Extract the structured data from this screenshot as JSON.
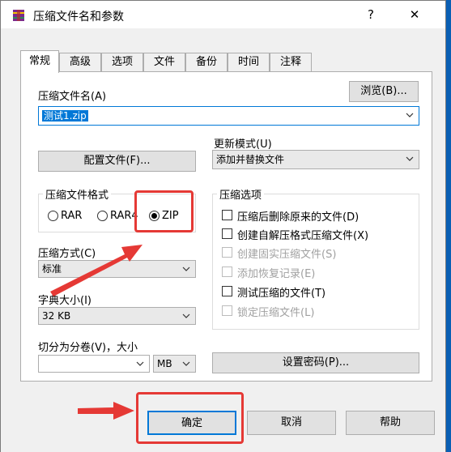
{
  "window": {
    "title": "压缩文件名和参数",
    "help_label": "?",
    "close_label": "✕"
  },
  "tabs": [
    "常规",
    "高级",
    "选项",
    "文件",
    "备份",
    "时间",
    "注释"
  ],
  "archive_name": {
    "label": "压缩文件名(A)",
    "value": "测试1.zip",
    "browse_label": "浏览(B)..."
  },
  "profiles_button": "配置文件(F)...",
  "update_mode": {
    "label": "更新模式(U)",
    "value": "添加并替换文件"
  },
  "format": {
    "title": "压缩文件格式",
    "options": [
      "RAR",
      "RAR4",
      "ZIP"
    ],
    "selected": "ZIP"
  },
  "method": {
    "label": "压缩方式(C)",
    "value": "标准"
  },
  "dictionary": {
    "label": "字典大小(I)",
    "value": "32 KB"
  },
  "split": {
    "label": "切分为分卷(V)，大小",
    "value": "",
    "unit": "MB"
  },
  "options": {
    "title": "压缩选项",
    "items": [
      {
        "label": "压缩后删除原来的文件(D)",
        "enabled": true,
        "checked": false
      },
      {
        "label": "创建自解压格式压缩文件(X)",
        "enabled": true,
        "checked": false
      },
      {
        "label": "创建固实压缩文件(S)",
        "enabled": false,
        "checked": false
      },
      {
        "label": "添加恢复记录(E)",
        "enabled": false,
        "checked": false
      },
      {
        "label": "测试压缩的文件(T)",
        "enabled": true,
        "checked": false
      },
      {
        "label": "锁定压缩文件(L)",
        "enabled": false,
        "checked": false
      }
    ]
  },
  "password_button": "设置密码(P)...",
  "buttons": {
    "ok": "确定",
    "cancel": "取消",
    "help": "帮助"
  },
  "colors": {
    "accent": "#0078d7",
    "annotation": "#e53935",
    "desktop": "#0a5fb4"
  }
}
